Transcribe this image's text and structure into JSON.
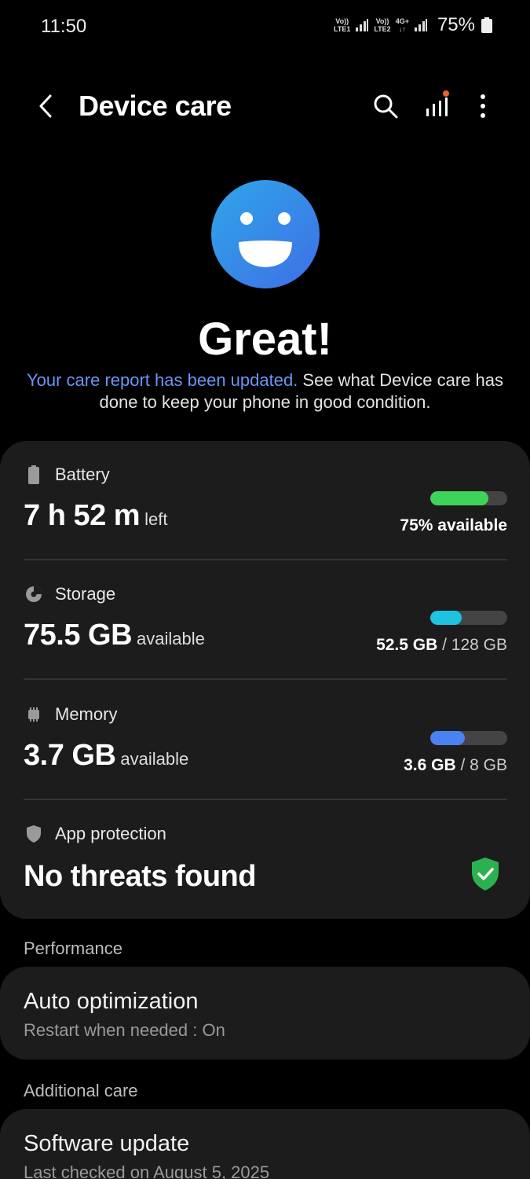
{
  "status": {
    "time": "11:50",
    "sim1_top": "Vo))",
    "sim1_bottom": "LTE1",
    "sim2_top": "Vo))",
    "sim2_bottom": "LTE2",
    "net_type": "4G+",
    "battery": "75%"
  },
  "header": {
    "title": "Device care"
  },
  "hero": {
    "title": "Great!",
    "link_text": "Your care report has been updated.",
    "desc_text": " See what Device care has done to keep your phone in good condition."
  },
  "battery": {
    "label": "Battery",
    "value": "7 h 52 m",
    "suffix": "left",
    "caption": "75% available",
    "level": 0.75,
    "color": "#3ed45a"
  },
  "storage": {
    "label": "Storage",
    "value": "75.5 GB",
    "suffix": "available",
    "used": "52.5 GB",
    "total": " / 128 GB",
    "level": 0.41,
    "color": "#1ec3e0"
  },
  "memory": {
    "label": "Memory",
    "value": "3.7 GB",
    "suffix": "available",
    "used": "3.6 GB",
    "total": " / 8 GB",
    "level": 0.45,
    "color": "#4a82f2"
  },
  "protection": {
    "label": "App protection",
    "value": "No threats found",
    "status_color": "#2bb14f"
  },
  "performance": {
    "section": "Performance",
    "title": "Auto optimization",
    "subtitle": "Restart when needed : On"
  },
  "additional": {
    "section": "Additional care",
    "title": "Software update",
    "subtitle": "Last checked on August 5, 2025"
  }
}
